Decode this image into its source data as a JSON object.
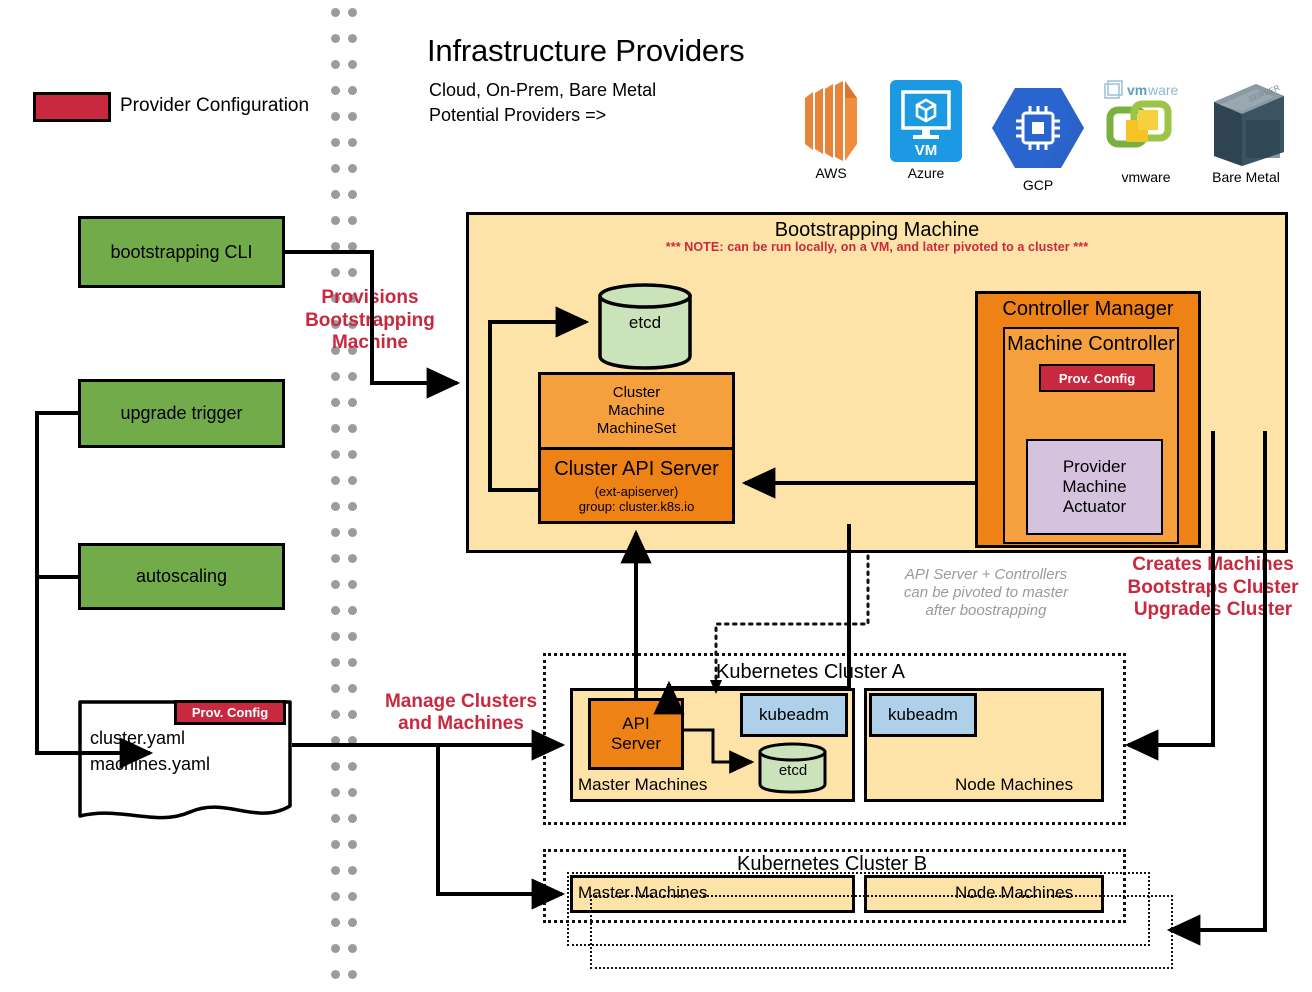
{
  "legend": {
    "swatch_color": "#c9293f",
    "label": "Provider Configuration"
  },
  "header": {
    "title": "Infrastructure Providers",
    "subtitle_line1": "Cloud, On-Prem, Bare Metal",
    "subtitle_line2": "Potential Providers =>"
  },
  "providers": [
    {
      "name": "AWS",
      "icon": "aws-icon"
    },
    {
      "name": "Azure",
      "icon": "azure-vm-icon",
      "badge": "VM"
    },
    {
      "name": "GCP",
      "icon": "gcp-icon"
    },
    {
      "name": "vmware",
      "icon": "vmware-icon",
      "wordmark": "vmware"
    },
    {
      "name": "Bare Metal",
      "icon": "bare-metal-server-icon"
    }
  ],
  "triggers": [
    {
      "label": "bootstrapping CLI"
    },
    {
      "label": "upgrade trigger"
    },
    {
      "label": "autoscaling"
    }
  ],
  "config_doc": {
    "badge": "Prov. Config",
    "line1": "cluster.yaml",
    "line2": "machines.yaml"
  },
  "annotations": {
    "provisions": "Provisions\nBootstrapping\nMachine",
    "provisions_lines": [
      "Provisions",
      "Bootstrapping",
      "Machine"
    ],
    "manage_lines": [
      "Manage Clusters",
      "and Machines"
    ],
    "creates_lines": [
      "Creates Machines",
      "Bootstraps Cluster",
      "Upgrades Cluster"
    ],
    "pivot_lines": [
      "API Server + Controllers",
      "can be pivoted to master",
      "after boostrapping"
    ]
  },
  "bootstrapping_machine": {
    "title": "Bootstrapping Machine",
    "note": "*** NOTE: can be run locally, on a VM, and later pivoted to a cluster ***",
    "etcd": "etcd",
    "crd_lines": [
      "Cluster",
      "Machine",
      "MachineSet"
    ],
    "api_server": {
      "title": "Cluster API Server",
      "sub1": "(ext-apiserver)",
      "sub2": "group: cluster.k8s.io"
    },
    "controller_manager": {
      "title": "Controller Manager",
      "machine_controller": "Machine Controller",
      "prov_config": "Prov. Config",
      "actuator_lines": [
        "Provider",
        "Machine",
        "Actuator"
      ]
    }
  },
  "cluster_a": {
    "title": "Kubernetes Cluster A",
    "master": {
      "label": "Master Machines",
      "api_server_lines": [
        "API",
        "Server"
      ],
      "kubeadm": "kubeadm",
      "etcd": "etcd"
    },
    "node": {
      "label": "Node Machines",
      "kubeadm": "kubeadm"
    }
  },
  "cluster_b": {
    "title": "Kubernetes Cluster B",
    "master_label": "Master Machines",
    "node_label": "Node Machines"
  },
  "colors": {
    "red": "#c9293f",
    "green": "#72ab49",
    "yellow": "#fde3a7",
    "orange": "#f5a03c",
    "orange_dark": "#ef8214",
    "purple": "#d5c2de",
    "blue": "#aed0e8",
    "etcd_green": "#cbe3bb",
    "gray_note": "#9a9a9a",
    "divider_dot": "#9b9b9b"
  }
}
